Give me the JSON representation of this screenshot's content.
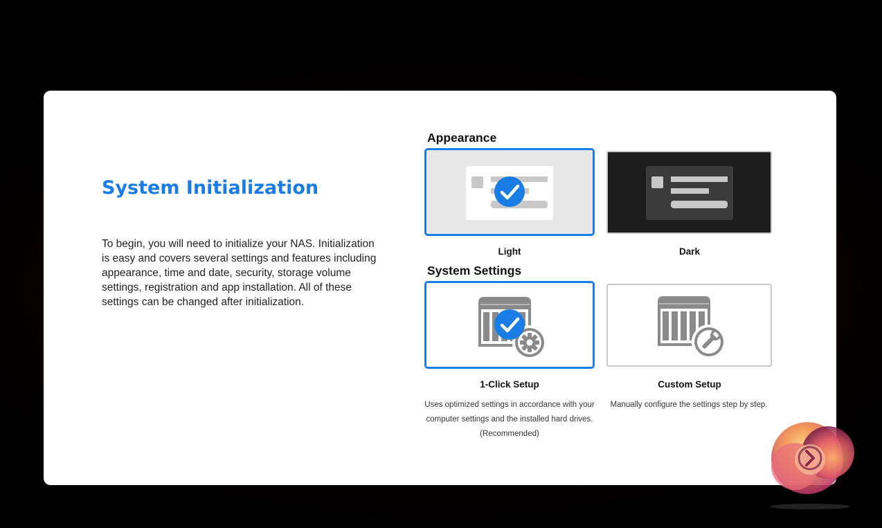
{
  "intro": {
    "title": "System Initialization",
    "description": "To begin, you will need to initialize your NAS. Initialization is easy and covers several settings and features including appearance, time and date, security, storage volume settings, registration and app installation. All of these settings can be changed after initialization."
  },
  "appearance": {
    "heading": "Appearance",
    "options": [
      {
        "label": "Light",
        "selected": true
      },
      {
        "label": "Dark",
        "selected": false
      }
    ]
  },
  "system_settings": {
    "heading": "System Settings",
    "options": [
      {
        "label": "1-Click Setup",
        "description": "Uses optimized settings in accordance with your computer settings and the installed hard drives. (Recommended)",
        "selected": true,
        "icon": "nas-gear-icon"
      },
      {
        "label": "Custom Setup",
        "description": "Manually configure the settings step by step.",
        "selected": false,
        "icon": "nas-wrench-icon"
      }
    ]
  },
  "colors": {
    "accent": "#1a7de6",
    "panel": "#ffffff",
    "light_card_bg": "#e8e8e8",
    "dark_card_bg": "#1c1c1c"
  }
}
